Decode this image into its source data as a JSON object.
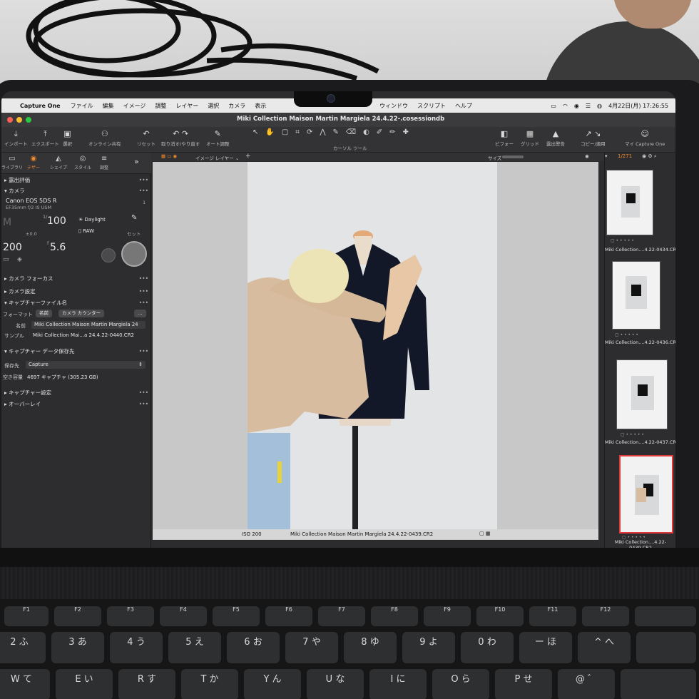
{
  "menubar": {
    "app": "Capture One",
    "items": [
      "ファイル",
      "編集",
      "イメージ",
      "調整",
      "レイヤー",
      "選択",
      "カメラ",
      "表示"
    ],
    "items_right": [
      "ウィンドウ",
      "スクリプト",
      "ヘルプ"
    ],
    "datetime": "4月22日(月)  17:26:55"
  },
  "window": {
    "title": "Miki Collection Maison Martin Margiela 24.4.22-.cosessiondb"
  },
  "toolbar": {
    "import": "インポート",
    "export": "エクスポート",
    "select": "選択",
    "online_share": "オンライン共有",
    "reset": "リセット",
    "undo_redo": "取り消す/やり直す",
    "auto_adjust": "オート調整",
    "cursor_tools": "カーソル ツール",
    "viewer": "ビフォー",
    "grid": "グリッド",
    "exposure_warning": "露出警告",
    "copy_apply": "コピー/適用",
    "my_capture_one": "マイ Capture One"
  },
  "tool_tabs": [
    "ライブラリ",
    "テザー",
    "シェイプ",
    "スタイル",
    "調整"
  ],
  "left_panel": {
    "exposure_eval": "露出評価",
    "camera": "カメラ",
    "camera_model": "Canon EOS 5DS R",
    "lens": "EF35mm f/2 IS USM",
    "shutter": "1/100",
    "shutter_prefix": "1/",
    "shutter_value": "100",
    "mode": "M",
    "wb": "Daylight",
    "format": "RAW",
    "exposure_comp": "±0.0",
    "set_label": "セット",
    "iso": "200",
    "aperture": "5.6",
    "aperture_prefix": "f",
    "camera_focus": "カメラ フォーカス",
    "camera_settings": "カメラ設定",
    "capture_filename": "キャプチャーファイル名",
    "format_label": "フォーマット",
    "name_chip": "名前",
    "counter_chip": "カメラ カウンター",
    "name_label": "名前",
    "name_value": "Miki Collection Maison Martin Margiela 24",
    "sample_label": "サンプル",
    "sample_value": "Miki Collection Mai...a 24.4.22-0440.CR2",
    "capture_location": "キャプチャー データ保存先",
    "save_to_label": "保存先",
    "save_to_value": "Capture",
    "free_space_label": "空き容量",
    "free_space_value": "4697 キャプチャ (305.23 GB)",
    "capture_settings": "キャプチャー設定",
    "overlay": "オーバーレイ"
  },
  "viewer": {
    "layer_label": "イメージ レイヤー",
    "size_label": "サイズ",
    "iso_caption": "ISO 200",
    "filename_caption": "Miki Collection Maison Martin Margiela 24.4.22-0439.CR2"
  },
  "filmstrip": {
    "counter": "1/271",
    "items": [
      {
        "label": "Miki Collection....4.22-0434.CR2"
      },
      {
        "label": "Miki Collection....4.22-0436.CR2"
      },
      {
        "label": "Miki Collection....4.22-0437.CR2"
      },
      {
        "label": "Miki Collection....4.22-0439.CR2"
      }
    ]
  },
  "keyboard": {
    "fn_row": [
      "F1",
      "F2",
      "F3",
      "F4",
      "F5",
      "F6",
      "F7",
      "F8",
      "F9",
      "F10",
      "F11",
      "F12"
    ],
    "num_row": [
      "2 ふ",
      "3 あ",
      "4 う",
      "5 え",
      "6 お",
      "7 や",
      "8 ゆ",
      "9 よ",
      "0 わ",
      "ー ほ",
      "^ へ"
    ],
    "qwerty_row": [
      "W て",
      "E い",
      "R す",
      "T か",
      "Y ん",
      "U な",
      "I に",
      "O ら",
      "P せ",
      "@ ゛"
    ]
  },
  "colors": {
    "accent": "#f08a2a",
    "selection": "#e23a3a",
    "panel": "#2d2d2f"
  }
}
